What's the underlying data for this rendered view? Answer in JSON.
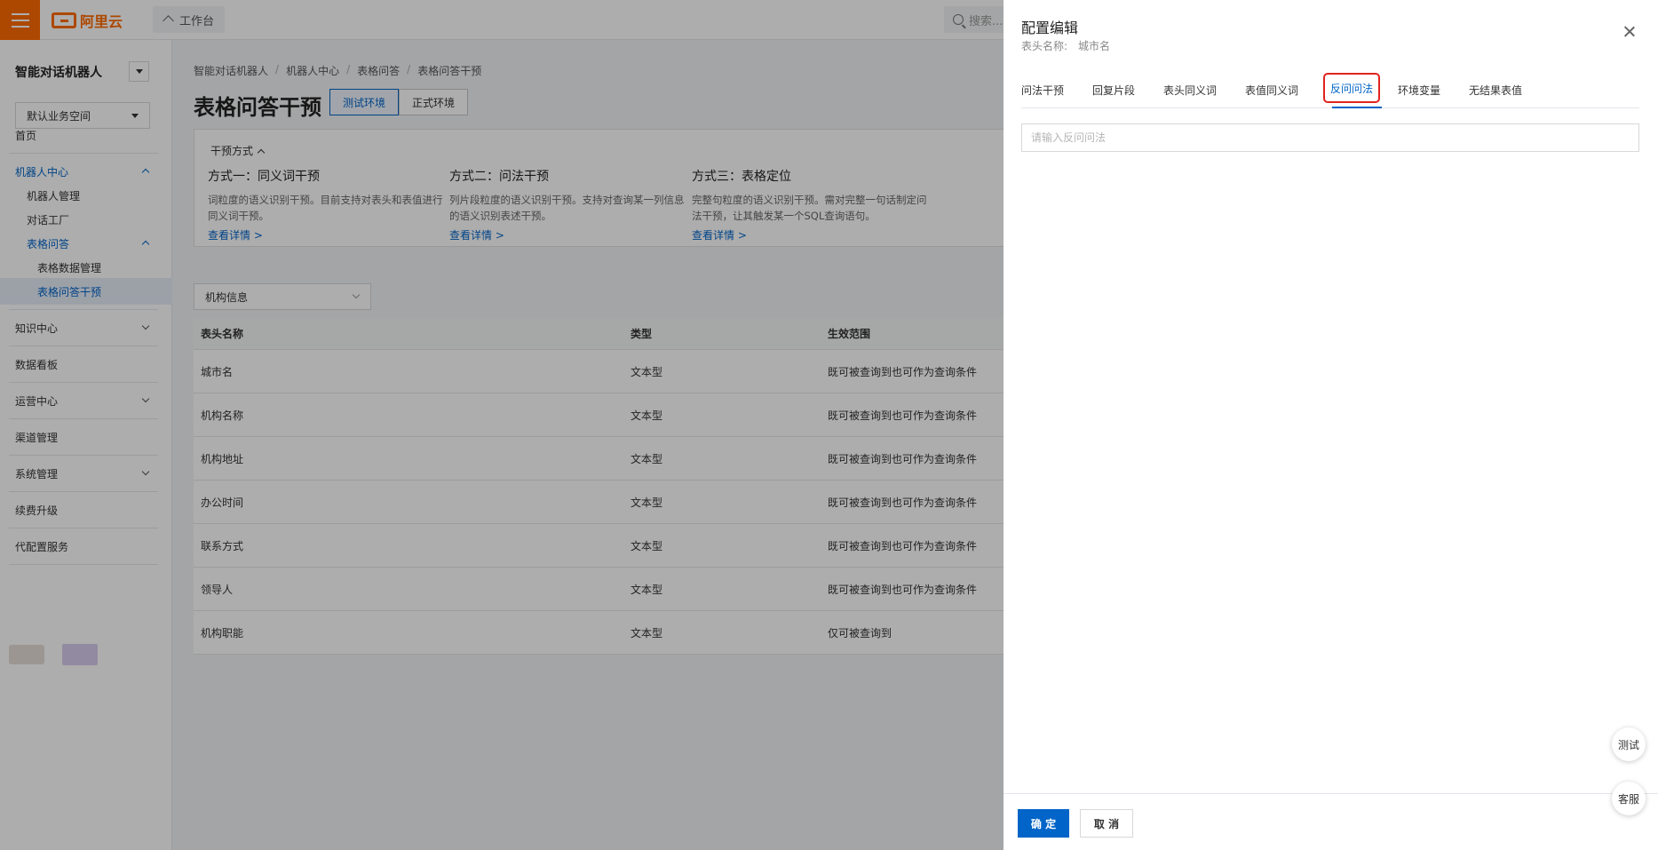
{
  "topbar": {
    "logo_text": "阿里云",
    "workbench_label": "工作台",
    "search_placeholder": "搜索..."
  },
  "sidebar": {
    "product_title": "智能对话机器人",
    "space_select": "默认业务空间",
    "items": [
      {
        "label": "首页"
      },
      {
        "label": "机器人中心"
      },
      {
        "label": "机器人管理"
      },
      {
        "label": "对话工厂"
      },
      {
        "label": "表格问答"
      },
      {
        "label": "表格数据管理"
      },
      {
        "label": "表格问答干预"
      },
      {
        "label": "知识中心"
      },
      {
        "label": "数据看板"
      },
      {
        "label": "运营中心"
      },
      {
        "label": "渠道管理"
      },
      {
        "label": "系统管理"
      },
      {
        "label": "续费升级"
      },
      {
        "label": "代配置服务"
      }
    ]
  },
  "main": {
    "breadcrumb": [
      "智能对话机器人",
      "机器人中心",
      "表格问答",
      "表格问答干预"
    ],
    "title": "表格问答干预",
    "env_tabs": [
      "测试环境",
      "正式环境"
    ],
    "intro": {
      "header": "干预方式",
      "methods": [
        {
          "title": "方式一：同义词干预",
          "desc": "词粒度的语义识别干预。目前支持对表头和表值进行同义词干预。",
          "link": "查看详情 >"
        },
        {
          "title": "方式二：问法干预",
          "desc": "列片段粒度的语义识别干预。支持对查询某一列信息的语义识别表述干预。",
          "link": "查看详情 >"
        },
        {
          "title": "方式三：表格定位",
          "desc": "完整句粒度的语义识别干预。需对完整一句话制定问法干预，让其触发某一个SQL查询语句。",
          "link": "查看详情 >"
        }
      ]
    },
    "filter_value": "机构信息",
    "table": {
      "headers": [
        "表头名称",
        "类型",
        "生效范围"
      ],
      "rows": [
        [
          "城市名",
          "文本型",
          "既可被查询到也可作为查询条件"
        ],
        [
          "机构名称",
          "文本型",
          "既可被查询到也可作为查询条件"
        ],
        [
          "机构地址",
          "文本型",
          "既可被查询到也可作为查询条件"
        ],
        [
          "办公时间",
          "文本型",
          "既可被查询到也可作为查询条件"
        ],
        [
          "联系方式",
          "文本型",
          "既可被查询到也可作为查询条件"
        ],
        [
          "领导人",
          "文本型",
          "既可被查询到也可作为查询条件"
        ],
        [
          "机构职能",
          "文本型",
          "仅可被查询到"
        ]
      ]
    }
  },
  "drawer": {
    "title": "配置编辑",
    "subtitle_label": "表头名称:",
    "subtitle_value": "城市名",
    "tabs": [
      "问法干预",
      "回复片段",
      "表头同义词",
      "表值同义词",
      "反问问法",
      "环境变量",
      "无结果表值"
    ],
    "active_tab": "反问问法",
    "input_placeholder": "请输入反问问法",
    "input_value": "",
    "ok_label": "确 定",
    "cancel_label": "取 消"
  },
  "floating": {
    "test_label": "测试",
    "service_label": "客服"
  },
  "colors": {
    "brand_orange": "#ff6a00",
    "primary_blue": "#0064c8",
    "highlight_red": "#e0241c"
  }
}
